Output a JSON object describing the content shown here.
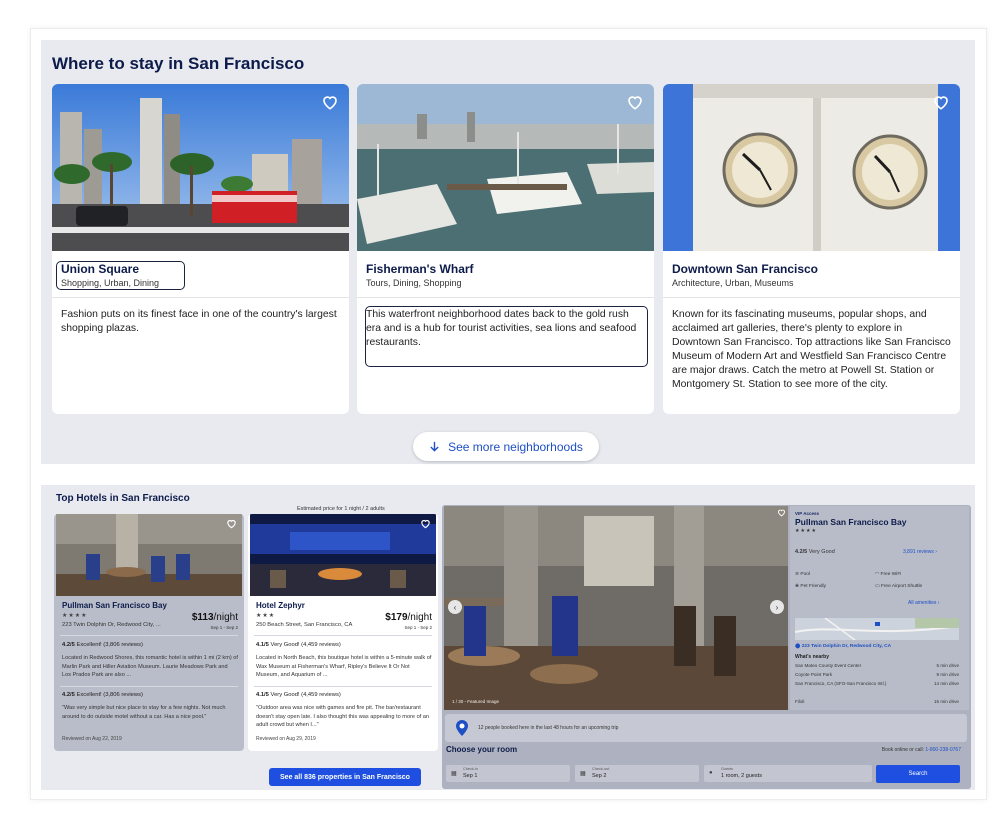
{
  "neighborhoods": {
    "title": "Where to stay in San Francisco",
    "cards": [
      {
        "name": "Union Square",
        "tags": "Shopping, Urban, Dining",
        "description": "Fashion puts on its finest face in one of the country's largest shopping plazas."
      },
      {
        "name": "Fisherman's Wharf",
        "tags": "Tours, Dining, Shopping",
        "description": "This waterfront neighborhood dates back to the gold rush era and is a hub for tourist activities, sea lions and seafood restaurants."
      },
      {
        "name": "Downtown San Francisco",
        "tags": "Architecture, Urban, Museums",
        "description": "Known for its fascinating museums, popular shops, and acclaimed art galleries, there's plenty to explore in Downtown San Francisco. Top attractions like San Francisco Museum of Modern Art and Westfield San Francisco Centre are major draws. Catch the metro at Powell St. Station or Montgomery St. Station to see more of the city."
      }
    ],
    "see_more": "See more neighborhoods"
  },
  "hotels": {
    "title": "Top Hotels in San Francisco",
    "estimate_note": "Estimated price for 1 night / 2 adults",
    "see_all": "See all 836 properties in San Francisco",
    "list": [
      {
        "name": "Pullman San Francisco Bay",
        "stars": "★★★★",
        "address": "223 Twin Dolphin Dr, Redwood City, ...",
        "price": "$113",
        "per": "/night",
        "dates": "Sep 1 - Sep 2",
        "rating1": "4.2/5",
        "rating1_text": "Excellent! (3,806 reviews)",
        "blurb": "Located in Redwood Shores, this romantic hotel is within 1 mi (2 km) of Marlin Park and Hiller Aviation Museum. Laurie Meadows Park and Los Prados Park are also ...",
        "rating2": "4.2/5",
        "rating2_text": "Excellent! (3,806 reviews)",
        "review": "\"Was very simple but nice place to stay for a few nights. Not much around to do outside motel without a car. Has a nice pool.\"",
        "reviewed": "Reviewed on Aug 22, 2019"
      },
      {
        "name": "Hotel Zephyr",
        "stars": "★★★",
        "address": "250 Beach Street, San Francisco, CA",
        "price": "$179",
        "per": "/night",
        "dates": "Sep 1 - Sep 2",
        "rating1": "4.1/5",
        "rating1_text": "Very Good! (4,459 reviews)",
        "blurb": "Located in North Beach, this boutique hotel is within a 5-minute walk of Wax Museum at Fisherman's Wharf, Ripley's Believe It Or Not Museum, and Aquarium of ...",
        "rating2": "4.1/5",
        "rating2_text": "Very Good! (4,459 reviews)",
        "review": "\"Outdoor area was nice with games and fire pit. The bar/restaurant doesn't stay open late. I also thought this was appealing to more of an adult crowd but when I...\"",
        "reviewed": "Reviewed on Aug 29, 2019"
      }
    ]
  },
  "detail": {
    "vip": "VIP Access",
    "name": "Pullman San Francisco Bay",
    "stars": "★★★★",
    "rating": "4.2/5",
    "rating_text": "Very Good",
    "reviews_link": "3,891 reviews ›",
    "amenities": [
      "Pool",
      "Free WiFi",
      "Pet Friendly",
      "Free Airport Shuttle"
    ],
    "all_amenities": "All amenities ›",
    "address": "223 Twin Dolphin Dr, Redwood City, CA",
    "nearby_title": "What's nearby",
    "nearby": [
      {
        "place": "San Mateo County Event Center",
        "time": "5 min drive"
      },
      {
        "place": "Coyote Point Park",
        "time": "9 min drive"
      },
      {
        "place": "San Francisco, CA (SFO-San Francisco Intl.)",
        "time": "14 min drive"
      },
      {
        "place": "Filoli",
        "time": "15 min drive"
      }
    ],
    "featured": "1 / 30 - Featured Image",
    "booked": "12 people booked here in the last 48 hours for an upcoming trip",
    "choose_room": "Choose your room",
    "book_call": "Book online or call:",
    "phone": "1-800-238-0767",
    "checkin_label": "Check-in",
    "checkin": "Sep 1",
    "checkout_label": "Check-out",
    "checkout": "Sep 2",
    "guests_label": "Guests",
    "guests": "1 room, 2 guests",
    "search": "Search"
  }
}
